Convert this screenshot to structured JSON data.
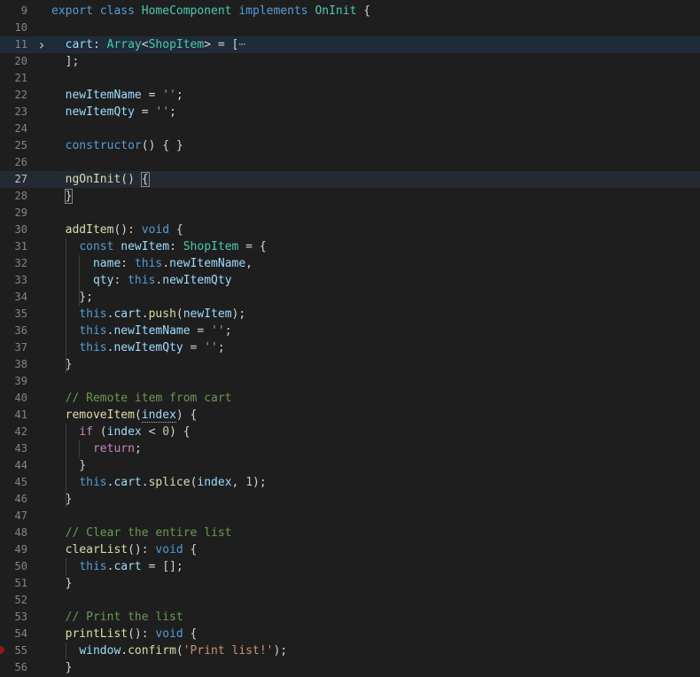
{
  "editor": {
    "lines": [
      {
        "num": "9",
        "text": "export class HomeComponent implements OnInit {"
      },
      {
        "num": "10",
        "text": ""
      },
      {
        "num": "11",
        "text": "  cart: Array<ShopItem> = [⋯",
        "folded": true
      },
      {
        "num": "20",
        "text": "  ];"
      },
      {
        "num": "21",
        "text": ""
      },
      {
        "num": "22",
        "text": "  newItemName = '';"
      },
      {
        "num": "23",
        "text": "  newItemQty = '';"
      },
      {
        "num": "24",
        "text": ""
      },
      {
        "num": "25",
        "text": "  constructor() { }"
      },
      {
        "num": "26",
        "text": ""
      },
      {
        "num": "27",
        "text": "  ngOnInit() {",
        "current": true
      },
      {
        "num": "28",
        "text": "  }"
      },
      {
        "num": "29",
        "text": ""
      },
      {
        "num": "30",
        "text": "  addItem(): void {"
      },
      {
        "num": "31",
        "text": "    const newItem: ShopItem = {"
      },
      {
        "num": "32",
        "text": "      name: this.newItemName,"
      },
      {
        "num": "33",
        "text": "      qty: this.newItemQty"
      },
      {
        "num": "34",
        "text": "    };"
      },
      {
        "num": "35",
        "text": "    this.cart.push(newItem);"
      },
      {
        "num": "36",
        "text": "    this.newItemName = '';"
      },
      {
        "num": "37",
        "text": "    this.newItemQty = '';"
      },
      {
        "num": "38",
        "text": "  }"
      },
      {
        "num": "39",
        "text": ""
      },
      {
        "num": "40",
        "text": "  // Remote item from cart"
      },
      {
        "num": "41",
        "text": "  removeItem(index) {"
      },
      {
        "num": "42",
        "text": "    if (index < 0) {"
      },
      {
        "num": "43",
        "text": "      return;"
      },
      {
        "num": "44",
        "text": "    }"
      },
      {
        "num": "45",
        "text": "    this.cart.splice(index, 1);"
      },
      {
        "num": "46",
        "text": "  }"
      },
      {
        "num": "47",
        "text": ""
      },
      {
        "num": "48",
        "text": "  // Clear the entire list"
      },
      {
        "num": "49",
        "text": "  clearList(): void {"
      },
      {
        "num": "50",
        "text": "    this.cart = [];"
      },
      {
        "num": "51",
        "text": "  }"
      },
      {
        "num": "52",
        "text": ""
      },
      {
        "num": "53",
        "text": "  // Print the list"
      },
      {
        "num": "54",
        "text": "  printList(): void {"
      },
      {
        "num": "55",
        "text": "    window.confirm('Print list!');",
        "breakpoint": true
      },
      {
        "num": "56",
        "text": "  }"
      }
    ],
    "fold_icon": "chevron-right-icon",
    "colors": {
      "background": "#1e1e1e",
      "keyword": "#569cd6",
      "control": "#c586c0",
      "function": "#dcdcaa",
      "type": "#4ec9b0",
      "property": "#9cdcfe",
      "string": "#ce9178",
      "number": "#b5cea8",
      "comment": "#6a9955",
      "line_number": "#858585"
    }
  }
}
